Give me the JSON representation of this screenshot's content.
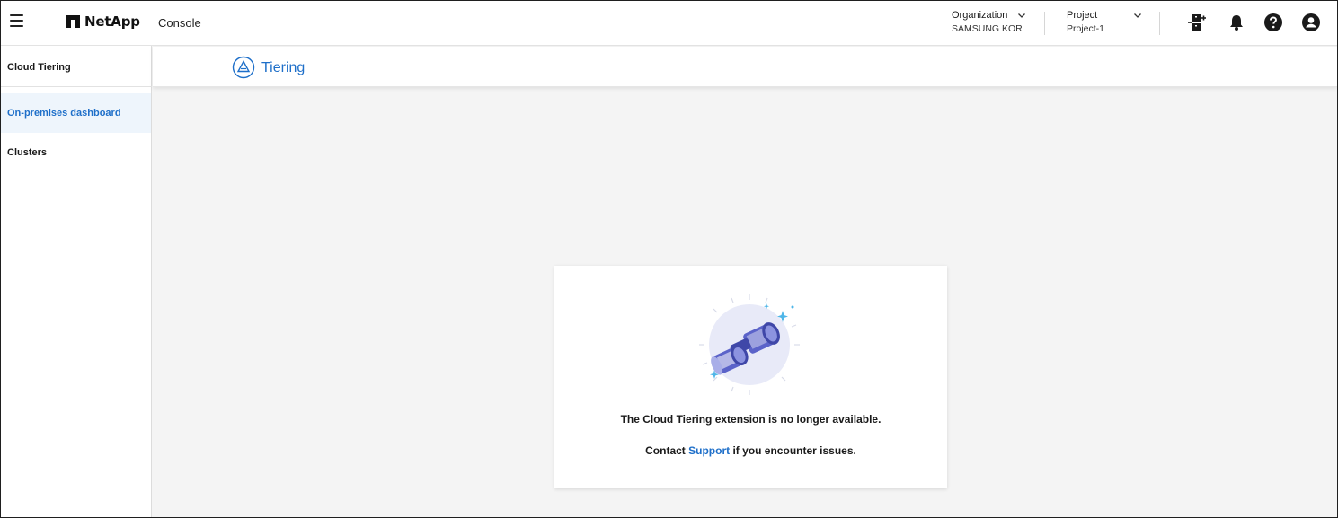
{
  "topbar": {
    "logo_text": "NetApp",
    "console_label": "Console",
    "organization": {
      "title": "Organization",
      "value": "SAMSUNG KOR"
    },
    "project": {
      "title": "Project",
      "value": "Project-1"
    },
    "icons": [
      "menu-icon",
      "connector-icon",
      "bell-icon",
      "help-icon",
      "account-icon"
    ]
  },
  "sidebar": {
    "title": "Cloud Tiering",
    "items": [
      {
        "label": "On-premises dashboard",
        "active": true
      },
      {
        "label": "Clusters",
        "active": false
      }
    ]
  },
  "header": {
    "title": "Tiering"
  },
  "card": {
    "message": "The Cloud Tiering extension is no longer available.",
    "contact_prefix": "Contact ",
    "support_link": "Support",
    "contact_suffix": " if you encounter issues."
  },
  "colors": {
    "accent": "#1e6fc9",
    "active_bg": "#eef5fc",
    "page_bg": "#f4f4f4",
    "illustration_circle": "#e8eaf8",
    "illustration_blue": "#5b63c9"
  }
}
